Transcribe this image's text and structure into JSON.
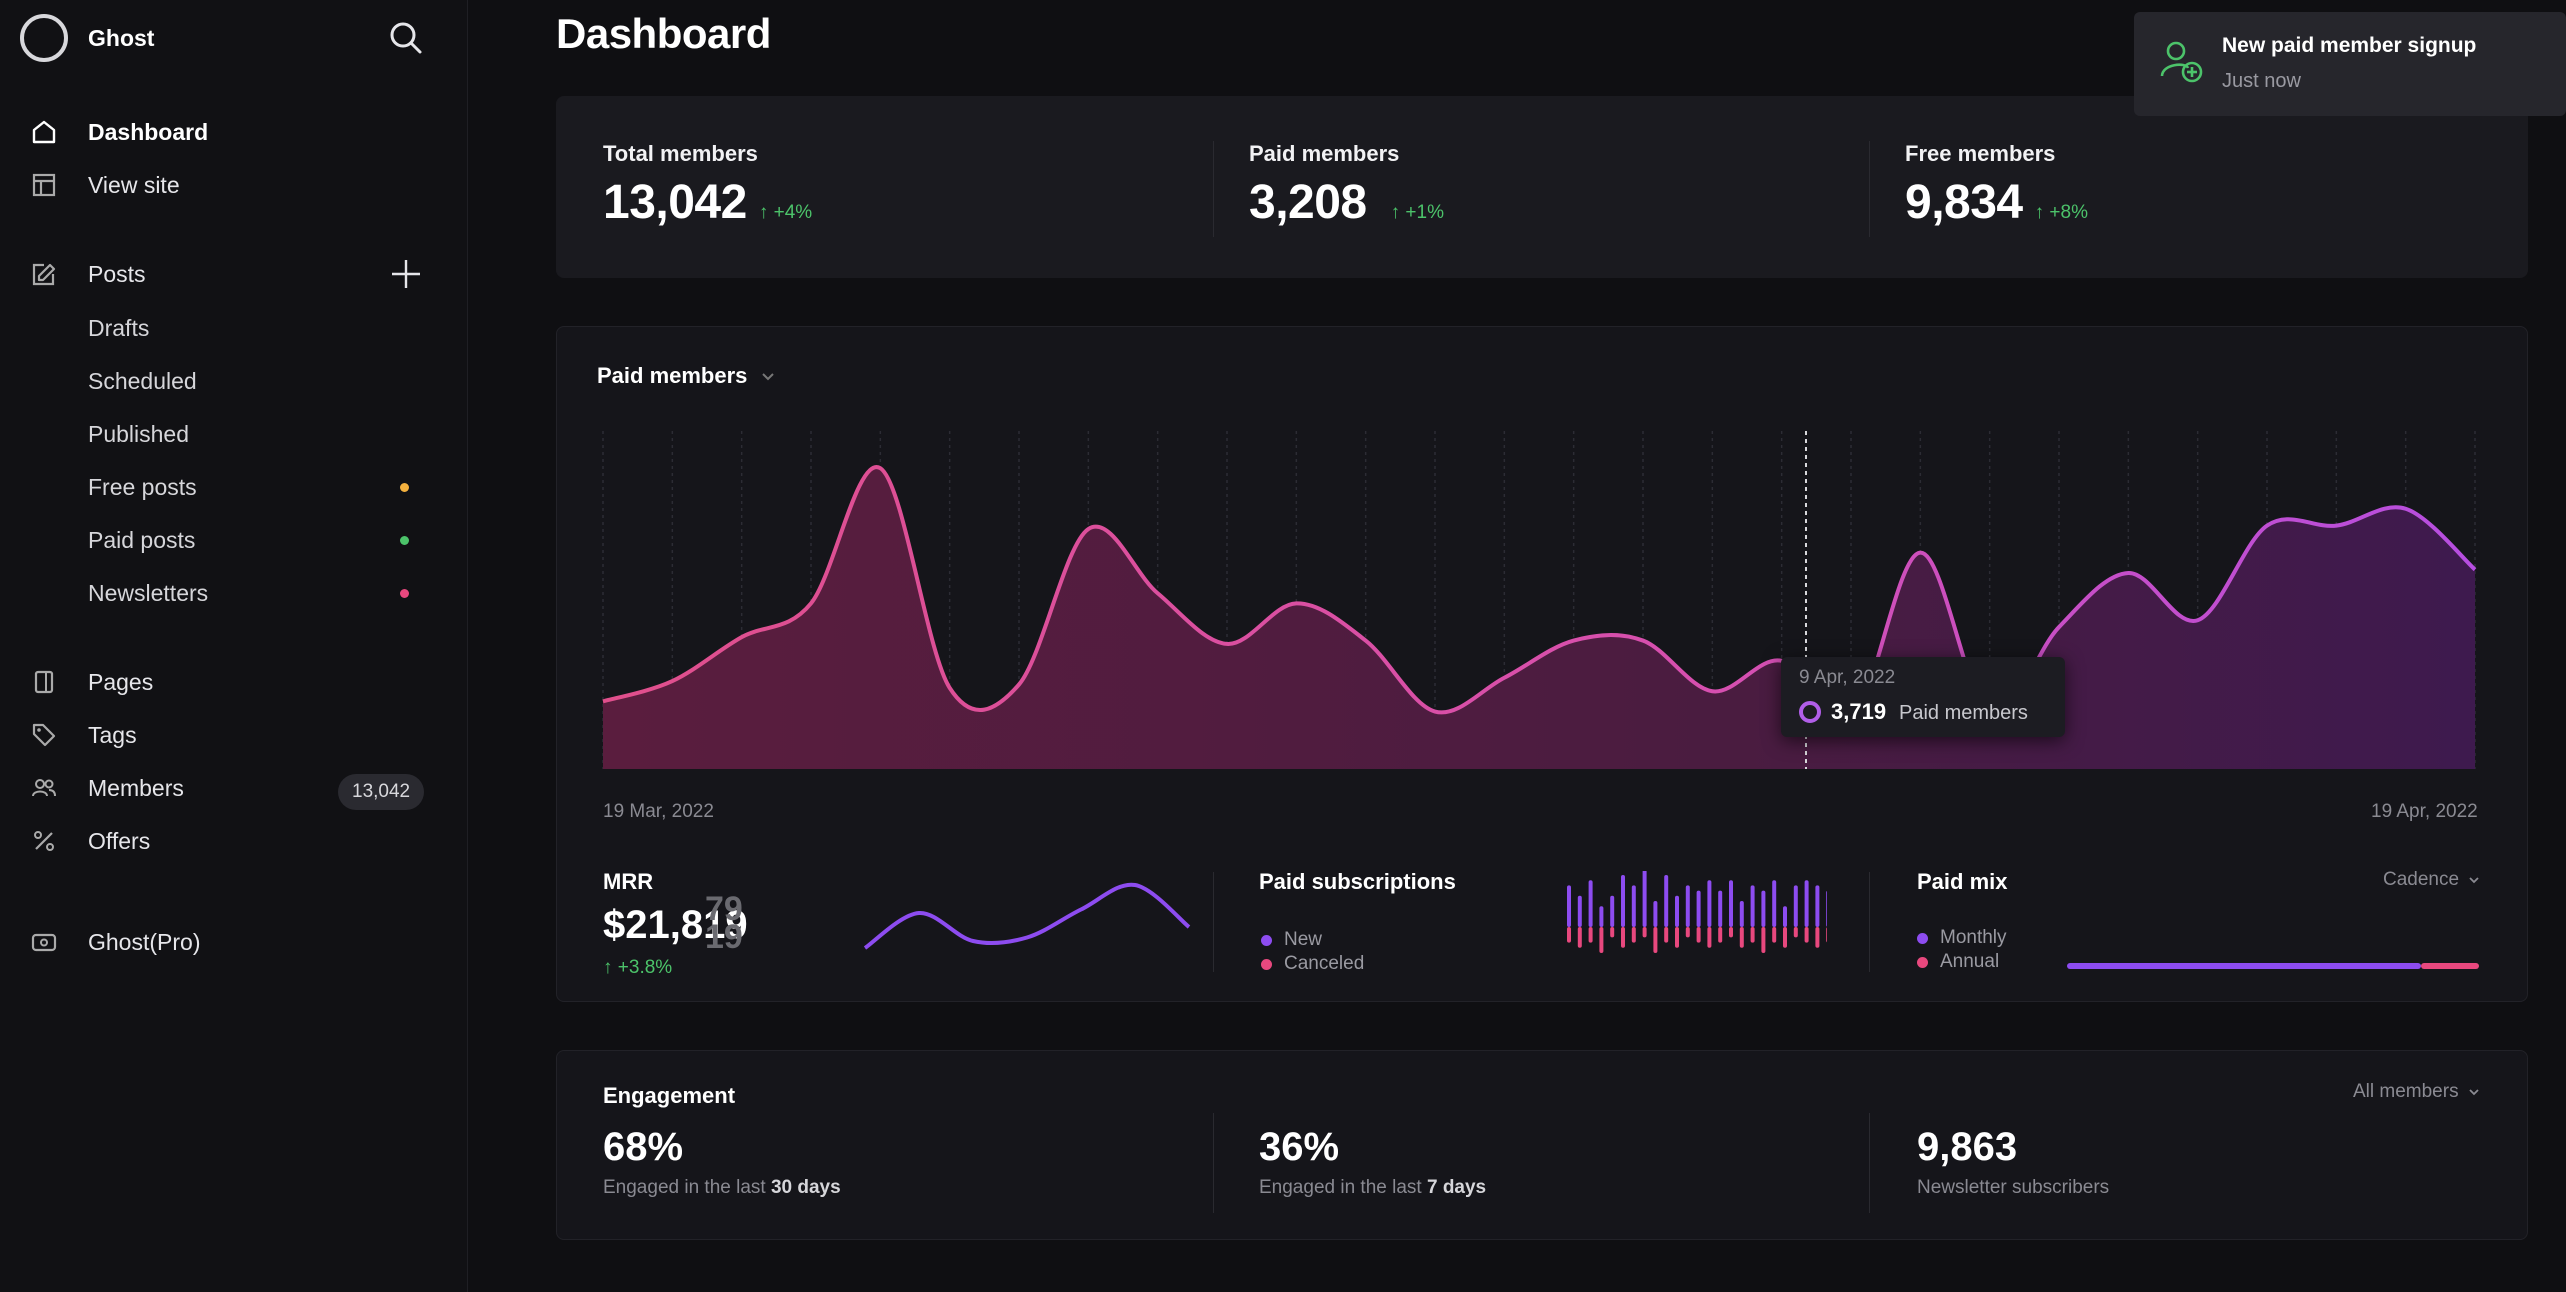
{
  "brand": {
    "name": "Ghost",
    "logo": "ghost-ring-logo"
  },
  "colors": {
    "accent_pink": "#e04fa0",
    "accent_purple": "#8d4cf0",
    "positive": "#4cc36a",
    "free_dot": "#f4b13e",
    "paid_dot": "#4cc36a",
    "newsletter_dot": "#e8487e"
  },
  "sidebar": {
    "items": [
      {
        "label": "Dashboard",
        "icon": "home-icon"
      },
      {
        "label": "View site",
        "icon": "layout-icon"
      },
      {
        "label": "Posts",
        "icon": "edit-icon"
      },
      {
        "label": "Drafts"
      },
      {
        "label": "Scheduled"
      },
      {
        "label": "Published"
      },
      {
        "label": "Free posts"
      },
      {
        "label": "Paid posts"
      },
      {
        "label": "Newsletters"
      },
      {
        "label": "Pages",
        "icon": "page-icon"
      },
      {
        "label": "Tags",
        "icon": "tag-icon"
      },
      {
        "label": "Members",
        "icon": "members-icon",
        "count": "13,042"
      },
      {
        "label": "Offers",
        "icon": "percent-icon"
      },
      {
        "label": "Ghost(Pro)",
        "icon": "ghost-pro-icon"
      }
    ]
  },
  "page": {
    "title": "Dashboard"
  },
  "stats": [
    {
      "label": "Total members",
      "value": "13,042",
      "delta": "+4%"
    },
    {
      "label": "Paid members",
      "value": "3,208",
      "delta": "+1%"
    },
    {
      "label": "Free members",
      "value": "9,834",
      "delta": "+8%"
    }
  ],
  "paid_chart": {
    "selector_label": "Paid members",
    "start_date": "19 Mar, 2022",
    "end_date": "19 Apr, 2022",
    "tooltip": {
      "date": "9 Apr, 2022",
      "value": "3,719",
      "label": "Paid members"
    }
  },
  "chart_data": {
    "type": "area",
    "series": [
      {
        "name": "Paid members",
        "values": [
          3200,
          3260,
          3390,
          3490,
          3890,
          3240,
          3250,
          3710,
          3520,
          3370,
          3490,
          3380,
          3170,
          3270,
          3380,
          3380,
          3230,
          3320,
          3140,
          3640,
          3160,
          3420,
          3580,
          3440,
          3720,
          3720,
          3770,
          3590
        ]
      }
    ],
    "xlabel": "",
    "ylabel": "",
    "x_ticks": [
      "19 Mar, 2022",
      "19 Apr, 2022"
    ],
    "grid": "vertical-dashed"
  },
  "mrr": {
    "label": "MRR",
    "value": "$21,819",
    "ghost_digits": [
      "79",
      "19"
    ],
    "delta": "+3.8%",
    "spark": [
      3,
      8,
      4,
      4.5,
      8.5,
      12,
      6
    ]
  },
  "subs": {
    "label": "Paid subscriptions",
    "legend": [
      "New",
      "Canceled"
    ],
    "new": [
      8,
      6,
      9,
      4,
      6,
      10,
      8,
      11,
      5,
      10,
      6,
      8,
      7,
      9,
      7,
      9,
      5,
      8,
      7,
      9,
      4,
      8,
      9,
      8,
      7
    ],
    "canceled": [
      3,
      4,
      3,
      5,
      2,
      4,
      3,
      2,
      5,
      3,
      4,
      2,
      3,
      4,
      3,
      2,
      4,
      3,
      5,
      3,
      4,
      2,
      3,
      4,
      3
    ]
  },
  "mix": {
    "label": "Paid mix",
    "legend": [
      "Monthly",
      "Annual"
    ],
    "cadence_label": "Cadence",
    "monthly_share": 0.86
  },
  "engagement": {
    "title": "Engagement",
    "filter_label": "All members",
    "items": [
      {
        "value": "68%",
        "desc": "Engaged in the last ",
        "desc_bold": "30 days"
      },
      {
        "value": "36%",
        "desc": "Engaged in the last ",
        "desc_bold": "7 days"
      },
      {
        "value": "9,863",
        "desc": "Newsletter subscribers",
        "desc_bold": ""
      }
    ]
  },
  "toast": {
    "title": "New paid member signup",
    "subtitle": "Just now",
    "icon": "user-add-icon"
  }
}
